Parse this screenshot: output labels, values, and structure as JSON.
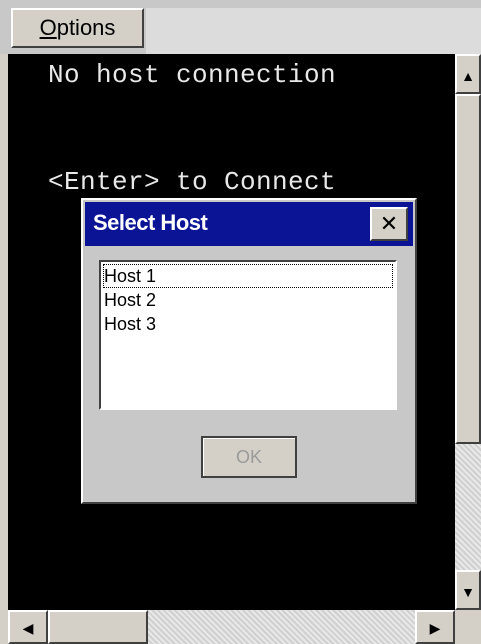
{
  "menubar": {
    "options_mnemonic": "O",
    "options_rest": "ptions"
  },
  "terminal": {
    "line1": "No host connection",
    "line2": "<Enter> to Connect"
  },
  "dialog": {
    "title": "Select Host",
    "close_glyph": "✕",
    "hosts": [
      "Host 1",
      "Host 2",
      "Host 3"
    ],
    "selected_index": 0,
    "ok_label": "OK",
    "ok_enabled": false
  },
  "scrollbars": {
    "up_arrow": "▲",
    "down_arrow": "▼",
    "left_arrow": "◀",
    "right_arrow": "▶"
  },
  "colors": {
    "terminal_bg": "#000000",
    "terminal_text": "#e8e8e8",
    "titlebar": "#0a1494",
    "dialog_bg": "#c8c8c8"
  }
}
